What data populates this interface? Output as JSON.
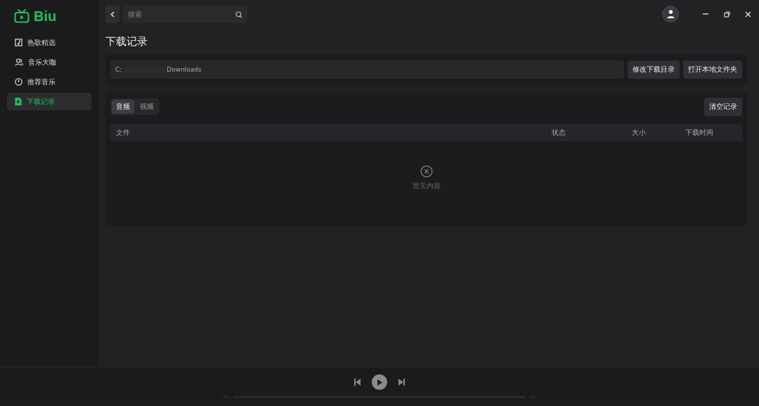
{
  "app": {
    "name": "Biu"
  },
  "sidebar": {
    "items": [
      {
        "label": "热歌精选",
        "selected": false
      },
      {
        "label": "音乐大咖",
        "selected": false
      },
      {
        "label": "推荐音乐",
        "selected": false
      },
      {
        "label": "下载记录",
        "selected": true
      }
    ]
  },
  "topbar": {
    "search": {
      "placeholder": "搜索"
    }
  },
  "page": {
    "title": "下载记录",
    "path": {
      "drive": "C:",
      "folder": "Downloads"
    },
    "buttons": [
      "修改下载目录",
      "打开本地文件夹"
    ]
  },
  "downloads": {
    "tabs": [
      {
        "label": "音频",
        "selected": true
      },
      {
        "label": "视频",
        "selected": false
      }
    ],
    "clear_button": "清空记录",
    "columns": [
      "文件",
      "状态",
      "大小",
      "下载时间"
    ],
    "empty_text": "暂无内容"
  },
  "player": {
    "elapsed": "-:--",
    "duration": "-:--"
  }
}
